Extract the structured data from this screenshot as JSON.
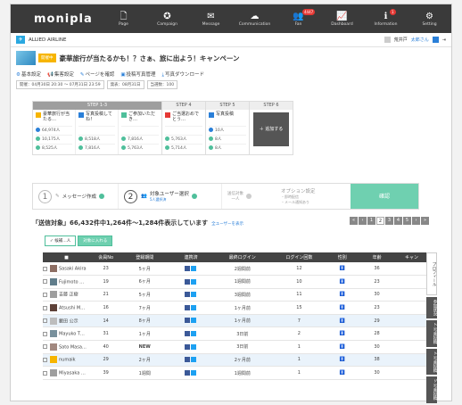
{
  "app": {
    "logo": "monipla"
  },
  "nav": [
    {
      "label": "Page",
      "icon": "page-icon",
      "glyph": "🗋"
    },
    {
      "label": "Campaign",
      "icon": "campaign-icon",
      "glyph": "✪"
    },
    {
      "label": "Message",
      "icon": "message-icon",
      "glyph": "✉"
    },
    {
      "label": "Communication",
      "icon": "communication-icon",
      "glyph": "☁"
    },
    {
      "label": "Fan",
      "icon": "fan-icon",
      "glyph": "👥",
      "badge": "4447"
    },
    {
      "label": "Dashboard",
      "icon": "dashboard-icon",
      "glyph": "📈"
    },
    {
      "label": "Information",
      "icon": "info-icon",
      "glyph": "ℹ",
      "badge": "1"
    },
    {
      "label": "Setting",
      "icon": "gear-icon",
      "glyph": "⚙"
    }
  ],
  "brand": {
    "name": "ALLIED AIRLINE"
  },
  "user": {
    "label1": "荒井戸",
    "label2": "太郎さん"
  },
  "campaign": {
    "tag": "開催中",
    "title": "豪華旅行が当たるかも！？さぁ、旅に出よう！キャンペーン",
    "actions": [
      "基本設定",
      "集客設定",
      "ページを確認",
      "投稿写真管理",
      "写真ダウンロード"
    ],
    "meta": [
      "開催：04月30日 20:30 〜 07月31日 23:59",
      "発表：08月31日",
      "当選数：100"
    ]
  },
  "steps": {
    "group1_label": "STEP 1-3",
    "step4_label": "STEP 4",
    "step5_label": "STEP 5",
    "step6_label": "STEP 6",
    "cells": [
      {
        "name": "豪華旅行が当たる…",
        "rows": [
          "64,974人",
          "10,175人",
          "8,525人"
        ]
      },
      {
        "name": "写真投稿してね！",
        "rows": [
          "",
          "8,518人",
          "7,816人"
        ]
      },
      {
        "name": "ご参加いただき…",
        "rows": [
          "",
          "7,816人",
          "5,763人"
        ]
      },
      {
        "name": "ご当選おめでとう…",
        "rows": [
          "",
          "5,763人",
          "5,714人"
        ]
      },
      {
        "name": "写真投稿",
        "rows": [
          "10人",
          "8人",
          "8人"
        ]
      }
    ],
    "add_label": "＋ 追加する"
  },
  "wizard": {
    "step1_num": "1",
    "step1_label": "メッセージ作成",
    "step2_num": "2",
    "step2_label": "対象ユーザー選択",
    "step2_sub": "5人選択済",
    "step3_label": "送信対象",
    "step3_sub": "一人",
    "step4_label": "オプション設定",
    "step4_sub1": "・即時配信",
    "step4_sub2": "・メール通知あり",
    "finish_label": "確認"
  },
  "counts": {
    "text": "「送信対象」66,432件中1,264件〜1,284件表示しています",
    "link": "全ユーザーを表示"
  },
  "pager": [
    "«",
    "‹",
    "1",
    "2",
    "3",
    "4",
    "5",
    "›",
    "»"
  ],
  "filters": {
    "f1": "✓ 候補…人",
    "f2": "対象に入れる"
  },
  "table": {
    "headers": [
      "■",
      "会員No",
      "登録期間",
      "連携済",
      "最終ログイン",
      "ログイン回数",
      "性別",
      "年齢",
      "キャン"
    ],
    "rows": [
      {
        "name": "Sasaki Akira",
        "no": "23",
        "period": "5ヶ月",
        "login": "2週間前",
        "count": "12",
        "gender": "m",
        "age": "36"
      },
      {
        "name": "Fujimoto …",
        "no": "19",
        "period": "6ヶ月",
        "login": "1週間前",
        "count": "10",
        "gender": "f",
        "age": "23"
      },
      {
        "name": "吉藤 正樹",
        "no": "21",
        "period": "5ヶ月",
        "login": "3週間前",
        "count": "11",
        "gender": "m",
        "age": "30"
      },
      {
        "name": "Atsushi M…",
        "no": "16",
        "period": "7ヶ月",
        "login": "1ヶ月前",
        "count": "15",
        "gender": "m",
        "age": "23"
      },
      {
        "name": "藪田 公示",
        "no": "14",
        "period": "8ヶ月",
        "login": "1ヶ月前",
        "count": "7",
        "gender": "m",
        "age": "29",
        "selected": true
      },
      {
        "name": "Mayuko T…",
        "no": "31",
        "period": "1ヶ月",
        "login": "3日前",
        "count": "2",
        "gender": "f",
        "age": "28"
      },
      {
        "name": "Sato Masa…",
        "no": "40",
        "period": "NEW",
        "login": "3日前",
        "count": "1",
        "gender": "m",
        "age": "30"
      },
      {
        "name": "numaik",
        "no": "29",
        "period": "2ヶ月",
        "login": "2ヶ月前",
        "count": "1",
        "gender": "m",
        "age": "38",
        "selected": true
      },
      {
        "name": "Miyasaka …",
        "no": "39",
        "period": "1週間",
        "login": "1週間前",
        "count": "1",
        "gender": "m",
        "age": "30"
      }
    ]
  },
  "sidetabs": [
    "プロフィール",
    "参加状況",
    "2. 写真投稿",
    "3. 写真投稿",
    "5. 写真投稿"
  ]
}
